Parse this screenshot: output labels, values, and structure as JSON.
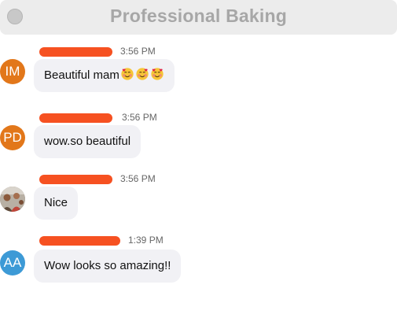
{
  "window": {
    "title": "Professional Baking"
  },
  "colors": {
    "redaction": "#f65121",
    "bubble_bg": "#f1f1f5",
    "avatar_im": "#e2771a",
    "avatar_pd": "#e2771a",
    "avatar_aa": "#3d9ad6"
  },
  "messages": [
    {
      "avatar_initials": "IM",
      "time": "3:56 PM",
      "text": "Beautiful mam",
      "emoji_icons": [
        "smiling-face-with-hearts-emoji",
        "smiling-face-with-hearts-emoji",
        "smiling-face-with-hearts-emoji"
      ]
    },
    {
      "avatar_initials": "PD",
      "time": "3:56 PM",
      "text": "wow.so beautiful"
    },
    {
      "avatar_initials": "",
      "avatar_icon": "profile-photo",
      "time": "3:56 PM",
      "text": "Nice"
    },
    {
      "avatar_initials": "AA",
      "time": "1:39 PM",
      "text": "Wow looks so amazing!!"
    }
  ]
}
